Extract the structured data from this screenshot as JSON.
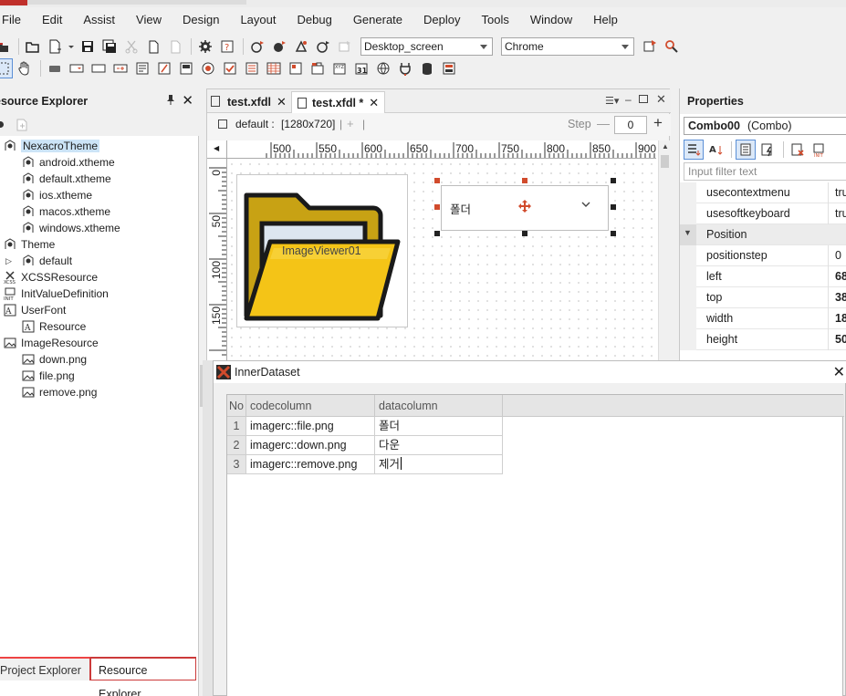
{
  "menu": [
    "File",
    "Edit",
    "Assist",
    "View",
    "Design",
    "Layout",
    "Debug",
    "Generate",
    "Deploy",
    "Tools",
    "Window",
    "Help"
  ],
  "toolbar": {
    "screen_combo": "Desktop_screen",
    "browser_combo": "Chrome"
  },
  "left_panel": {
    "title": "esource Explorer",
    "tree": [
      {
        "label": "NexacroTheme",
        "level": 0,
        "icon": "theme-icon",
        "selected": true
      },
      {
        "label": "android.xtheme",
        "level": 1,
        "icon": "xtheme-icon"
      },
      {
        "label": "default.xtheme",
        "level": 1,
        "icon": "xtheme-icon"
      },
      {
        "label": "ios.xtheme",
        "level": 1,
        "icon": "xtheme-icon"
      },
      {
        "label": "macos.xtheme",
        "level": 1,
        "icon": "xtheme-icon"
      },
      {
        "label": "windows.xtheme",
        "level": 1,
        "icon": "xtheme-icon"
      },
      {
        "label": "Theme",
        "level": 0,
        "icon": "theme-icon"
      },
      {
        "label": "default",
        "level": 1,
        "icon": "xtheme-icon",
        "expander": true
      },
      {
        "label": "XCSSResource",
        "level": 0,
        "icon": "xcss-icon"
      },
      {
        "label": "InitValueDefinition",
        "level": 0,
        "icon": "init-icon"
      },
      {
        "label": "UserFont",
        "level": 0,
        "icon": "font-icon"
      },
      {
        "label": "Resource",
        "level": 1,
        "icon": "font-file-icon"
      },
      {
        "label": "ImageResource",
        "level": 0,
        "icon": "image-folder-icon"
      },
      {
        "label": "down.png",
        "level": 1,
        "icon": "image-file-icon"
      },
      {
        "label": "file.png",
        "level": 1,
        "icon": "image-file-icon"
      },
      {
        "label": "remove.png",
        "level": 1,
        "icon": "image-file-icon"
      }
    ],
    "tabs": [
      "Project Explorer",
      "Resource Explorer"
    ]
  },
  "center": {
    "tabs": [
      {
        "label": "test.xfdl",
        "active": false
      },
      {
        "label": "test.xfdl *",
        "active": true
      }
    ],
    "screen_label": "default :",
    "screen_size": "[1280x720]",
    "plus": "+",
    "step_label": "Step",
    "step_value": "0",
    "ruler_h": [
      "500",
      "550",
      "600",
      "650",
      "700",
      "750",
      "800",
      "850",
      "900"
    ],
    "ruler_v": [
      "0",
      "50",
      "100",
      "150"
    ],
    "imageviewer_label": "ImageViewer01",
    "combo_value": "폴더"
  },
  "properties": {
    "title": "Properties",
    "object": "Combo00",
    "object_type": "(Combo)",
    "filter_placeholder": "Input filter text",
    "rows": [
      {
        "name": "usecontextmenu",
        "value": "tru",
        "bold": false
      },
      {
        "name": "usesoftkeyboard",
        "value": "tru",
        "bold": false
      },
      {
        "name": "Position",
        "value": "",
        "category": true
      },
      {
        "name": "positionstep",
        "value": "0",
        "bold": false
      },
      {
        "name": "left",
        "value": "68",
        "bold": true
      },
      {
        "name": "top",
        "value": "38",
        "bold": true
      },
      {
        "name": "width",
        "value": "18",
        "bold": true
      },
      {
        "name": "height",
        "value": "50",
        "bold": true
      }
    ]
  },
  "dataset": {
    "title": "InnerDataset",
    "columns": [
      "No",
      "codecolumn",
      "datacolumn"
    ],
    "rows": [
      [
        "1",
        "imagerc::file.png",
        "폴더"
      ],
      [
        "2",
        "imagerc::down.png",
        "다운"
      ],
      [
        "3",
        "imagerc::remove.png",
        "제거"
      ]
    ]
  },
  "colors": {
    "accent_red": "#d14b2c",
    "selection": "#cce4f7",
    "folder_yellow": "#f4c417"
  }
}
